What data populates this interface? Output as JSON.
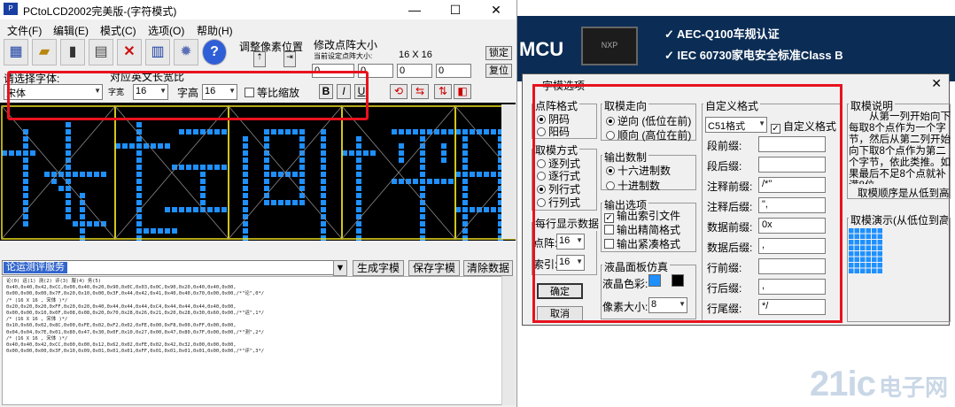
{
  "app": {
    "title": "PCtoLCD2002完美版-(字符模式)",
    "icon_text": "P",
    "window_controls": [
      "—",
      "☐",
      "✕"
    ],
    "menu": [
      "文件(F)",
      "编辑(E)",
      "模式(C)",
      "选项(O)",
      "帮助(H)"
    ],
    "toolbar": {
      "adjust_pixel_label": "调整像素位置",
      "modify_matrix_label": "修改点阵大小",
      "current_size_label": "当前设定点阵大小:",
      "current_size_value": "16 X 16",
      "lock_button": "锁定",
      "reset_button": "复位",
      "spin_values": [
        "0",
        "0",
        "0",
        "0",
        "0"
      ]
    },
    "font_select_label": "请选择字体:",
    "font_value": "宋体",
    "wide_ratio_label": "对应英文长宽比",
    "char_width_label": "字宽",
    "char_width_value": "16",
    "char_height_label": "字高",
    "char_height_value": "16",
    "proportional_label": "等比缩放",
    "style_buttons": [
      "B",
      "I",
      "U"
    ],
    "input_text": "论运测评服务",
    "generate_button": "生成字模",
    "save_button": "保存字模",
    "clear_button": "清除数据",
    "output_lines": [
      "论(0) 运(1) 测(2) 评(3) 服(4) 务(5)",
      "",
      "0x40,0x40,0x42,0xCC,0x00,0x40,0x20,0x90,0x0C,0x03,0x0C,0x90,0x20,0x40,0x40,0x00,",
      "0x00,0x00,0x00,0x7F,0x20,0x10,0x00,0x3F,0x44,0x42,0x41,0x40,0x40,0x70,0x00,0x00,/*\"论\",0*/",
      "/* (16 X 16 , 宋体 )*/",
      "",
      "0x20,0x20,0x20,0xFF,0x20,0x20,0x40,0x44,0x44,0x44,0xC4,0x44,0x44,0x44,0x40,0x00,",
      "0x00,0x00,0x10,0x0F,0x08,0x08,0x20,0x70,0x28,0x26,0x21,0x20,0x28,0x30,0x60,0x00,/*\"运\",1*/",
      "/* (16 X 16 , 宋体 )*/",
      "",
      "0x10,0x60,0x02,0x8C,0x00,0xFE,0x02,0xF2,0x02,0xFE,0x00,0xF8,0x00,0xFF,0x00,0x00,",
      "0x04,0x04,0x7E,0x01,0x80,0x47,0x30,0x0F,0x10,0x27,0x00,0x47,0x80,0x7F,0x00,0x00,/*\"测\",2*/",
      "/* (16 X 16 , 宋体 )*/",
      "",
      "0x40,0x40,0x42,0xCC,0x00,0x00,0x12,0x62,0x02,0xFE,0x02,0x42,0x32,0x00,0x00,0x00,",
      "0x00,0x00,0x00,0x3F,0x10,0x09,0x01,0x01,0x01,0xFF,0x01,0x01,0x01,0x01,0x00,0x00,/*\"评\",3*/"
    ],
    "lcd_glyph_hint": "论运测评服"
  },
  "web": {
    "banner_brand": "MCU",
    "banner_chip": "NXP",
    "bullets": [
      "✓ AEC-Q100车规认证",
      "✓ IEC 60730家电安全标准Class B"
    ],
    "watermark": "21ic",
    "watermark_cn": "电子网"
  },
  "dialog": {
    "title": "字模选项",
    "close": "✕",
    "matrix_format": {
      "title": "点阵格式",
      "options": [
        "阴码",
        "阳码"
      ],
      "selected": 0
    },
    "scan_mode": {
      "title": "取模方式",
      "options": [
        "逐列式",
        "逐行式",
        "列行式",
        "行列式"
      ],
      "selected": 2
    },
    "per_line": {
      "title": "每行显示数据",
      "matrix_label": "点阵:",
      "matrix_value": "16",
      "index_label": "索引:",
      "index_value": "16"
    },
    "ok_button": "确定",
    "cancel_button": "取消",
    "direction": {
      "title": "取模走向",
      "options": [
        "逆向 (低位在前)",
        "顺向 (高位在前)"
      ],
      "selected": 0
    },
    "number_system": {
      "title": "输出数制",
      "options": [
        "十六进制数",
        "十进制数"
      ],
      "selected": 0
    },
    "output_options": {
      "title": "输出选项",
      "options": [
        "输出索引文件",
        "输出精简格式",
        "输出紧凑格式"
      ],
      "checked": [
        true,
        false,
        false
      ]
    },
    "lcd_sim": {
      "title": "液晶面板仿真",
      "color_label": "液晶色彩:",
      "pixel_size_label": "像素大小:",
      "pixel_size_value": "8",
      "on_color": "#1e90ff",
      "off_color": "#000000"
    },
    "custom_format": {
      "title": "自定义格式",
      "format_value": "C51格式",
      "custom_checkbox": "自定义格式",
      "rows": [
        {
          "label": "段前缀:",
          "value": ""
        },
        {
          "label": "段后缀:",
          "value": ""
        },
        {
          "label": "注释前缀:",
          "value": "/*\""
        },
        {
          "label": "注释后缀:",
          "value": "\","
        },
        {
          "label": "数据前缀:",
          "value": "0x"
        },
        {
          "label": "数据后缀:",
          "value": ","
        },
        {
          "label": "行前缀:",
          "value": ""
        },
        {
          "label": "行后缀:",
          "value": ","
        },
        {
          "label": "行尾缀:",
          "value": "*/"
        }
      ]
    },
    "explain": {
      "title": "取模说明",
      "text": "从第一列开始向下每取8个点作为一个字节，然后从第二列开始向下取8个点作为第二个字节，依此类推。如果最后不足8个点就补满8位。",
      "order": "取模顺序是从低到高",
      "demo_title": "取模演示(从低位到高位)"
    }
  },
  "highlight_color": "#e8121e"
}
